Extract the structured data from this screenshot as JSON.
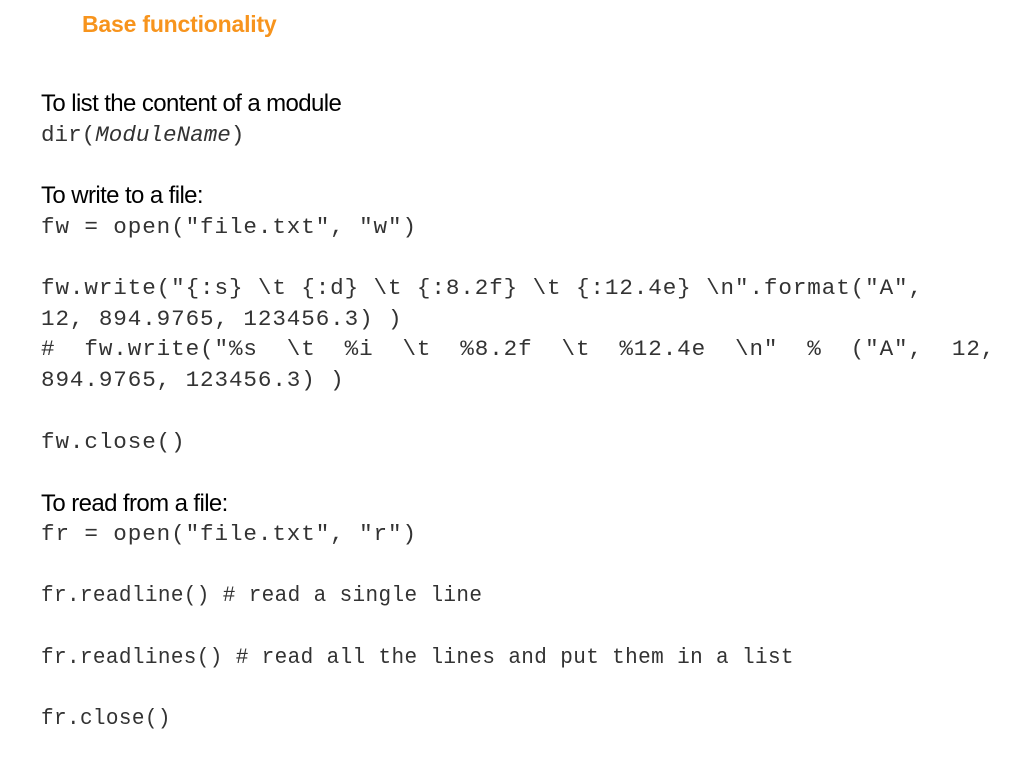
{
  "slide": {
    "title": "Base functionality",
    "accent_color": "#f7941d",
    "sections": {
      "list_module": {
        "heading": "To list the content of a module",
        "code_prefix": "dir(",
        "code_arg": "ModuleName",
        "code_suffix": ")"
      },
      "write_file": {
        "heading": "To write to a file:",
        "open_line": "fw = open(\"file.txt\", \"w\")",
        "write_line_1": "fw.write(\"{:s} \\t {:d} \\t {:8.2f} \\t {:12.4e} \\n\".format(\"A\",",
        "write_line_2": "12, 894.9765, 123456.3) )",
        "comment_line_1": "#  fw.write(\"%s  \\t  %i  \\t  %8.2f  \\t  %12.4e  \\n\"  %  (\"A\",  12,",
        "comment_line_2": "894.9765, 123456.3) )",
        "close_line": "fw.close()"
      },
      "read_file": {
        "heading": "To read from a file:",
        "open_line": "fr = open(\"file.txt\", \"r\")",
        "readline_line": "fr.readline() # read a single line",
        "readlines_line": "fr.readlines() # read all the lines and put them in a list",
        "close_line": "fr.close()"
      }
    }
  }
}
